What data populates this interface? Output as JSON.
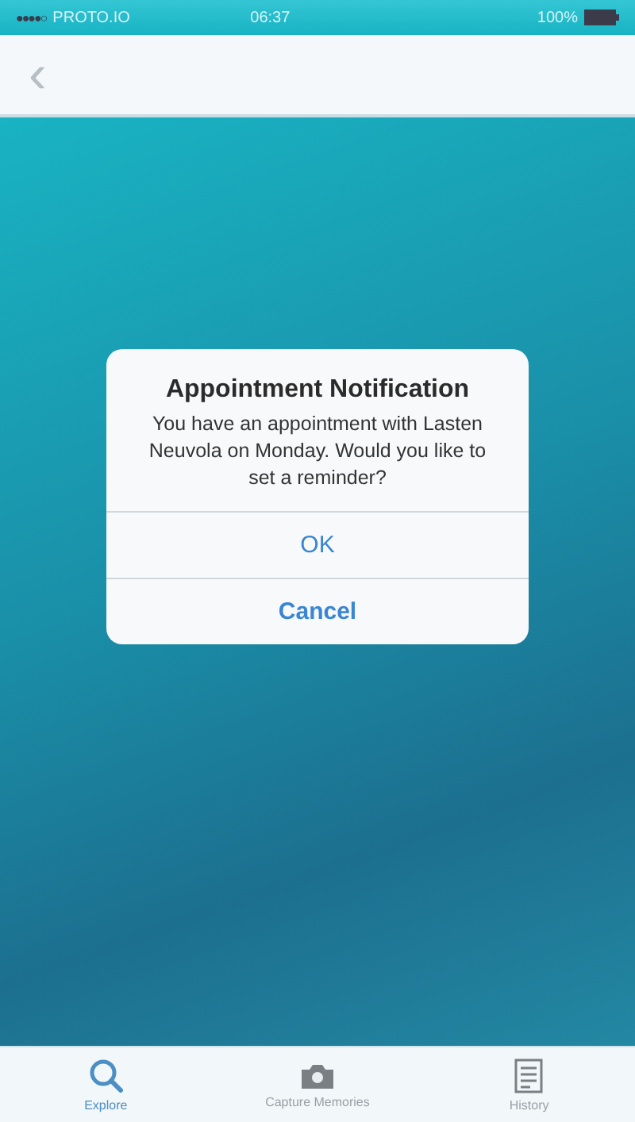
{
  "status_bar": {
    "signal": "●●●●○",
    "carrier": "PROTO.IO",
    "time": "06:37",
    "battery": "100%"
  },
  "nav_bar": {
    "back": "‹"
  },
  "dialog": {
    "title": "Appointment Notification",
    "message": "You have an appointment with Lasten Neuvola on Monday. Would you like to set a reminder?",
    "buttons": [
      {
        "label": "OK",
        "kind": "plain"
      },
      {
        "label": "Cancel",
        "kind": "bold"
      }
    ]
  },
  "tab_bar": [
    {
      "label": "Explore",
      "kind": "search",
      "selected": true
    },
    {
      "label": "Capture Memories",
      "kind": "camera",
      "selected": false
    },
    {
      "label": "History",
      "kind": "list",
      "selected": false
    }
  ]
}
